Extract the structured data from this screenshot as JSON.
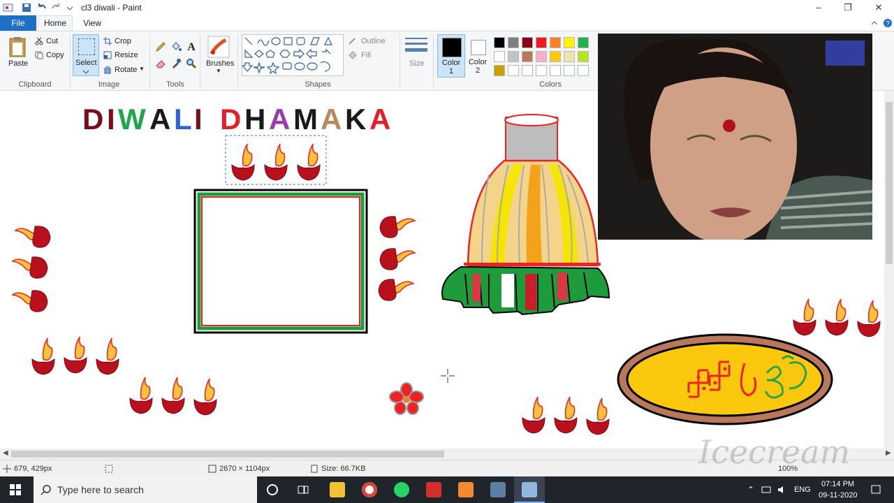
{
  "window": {
    "title": "cl3 diwali - Paint"
  },
  "tabs": [
    {
      "label": "File"
    },
    {
      "label": "Home"
    },
    {
      "label": "View"
    }
  ],
  "ribbon": {
    "clipboard": {
      "paste": "Paste",
      "cut": "Cut",
      "copy": "Copy",
      "group": "Clipboard"
    },
    "image": {
      "select": "Select",
      "crop": "Crop",
      "resize": "Resize",
      "rotate": "Rotate",
      "group": "Image"
    },
    "tools": {
      "group": "Tools"
    },
    "brushes": {
      "label": "Brushes"
    },
    "shapes": {
      "outline": "Outline",
      "fill": "Fill",
      "group": "Shapes"
    },
    "size": {
      "label": "Size"
    },
    "colors": {
      "color1": "Color 1",
      "color2": "Color 2",
      "group": "Colors",
      "palette_row1": [
        "#000000",
        "#7f7f7f",
        "#880015",
        "#ed1c24",
        "#ff7f27",
        "#fff200",
        "#22b14c"
      ],
      "palette_row2": [
        "#ffffff",
        "#c3c3c3",
        "#b97a57",
        "#ffaec9",
        "#ffc90e",
        "#efe4b0",
        "#b5e61d"
      ],
      "palette_row3": [
        "#c8a000",
        "#ffffff",
        "#ffffff",
        "#ffffff",
        "#ffffff",
        "#ffffff",
        "#ffffff"
      ]
    }
  },
  "canvas": {
    "heading_letters": [
      {
        "ch": "D",
        "color": "#7a0c1c"
      },
      {
        "ch": "I",
        "color": "#7a0c1c"
      },
      {
        "ch": "W",
        "color": "#22a64a"
      },
      {
        "ch": "A",
        "color": "#1a1a1a"
      },
      {
        "ch": "L",
        "color": "#2b63d6"
      },
      {
        "ch": "I",
        "color": "#7a0c1c"
      },
      {
        "ch": " ",
        "color": "#000"
      },
      {
        "ch": "D",
        "color": "#e0202a"
      },
      {
        "ch": "H",
        "color": "#1a1a1a"
      },
      {
        "ch": "A",
        "color": "#9b3bb0"
      },
      {
        "ch": "M",
        "color": "#1a1a1a"
      },
      {
        "ch": "A",
        "color": "#b8895a"
      },
      {
        "ch": "K",
        "color": "#1a1a1a"
      },
      {
        "ch": "A",
        "color": "#e0202a"
      }
    ]
  },
  "statusbar": {
    "cursor_pos": "679, 429px",
    "canvas_size": "2670 × 1104px",
    "file_size": "Size: 66.7KB",
    "zoom": "100%"
  },
  "taskbar": {
    "search_placeholder": "Type here to search",
    "lang": "ENG",
    "time": "07:14 PM",
    "date": "09-11-2020"
  },
  "watermark": {
    "text": "Icecream"
  }
}
